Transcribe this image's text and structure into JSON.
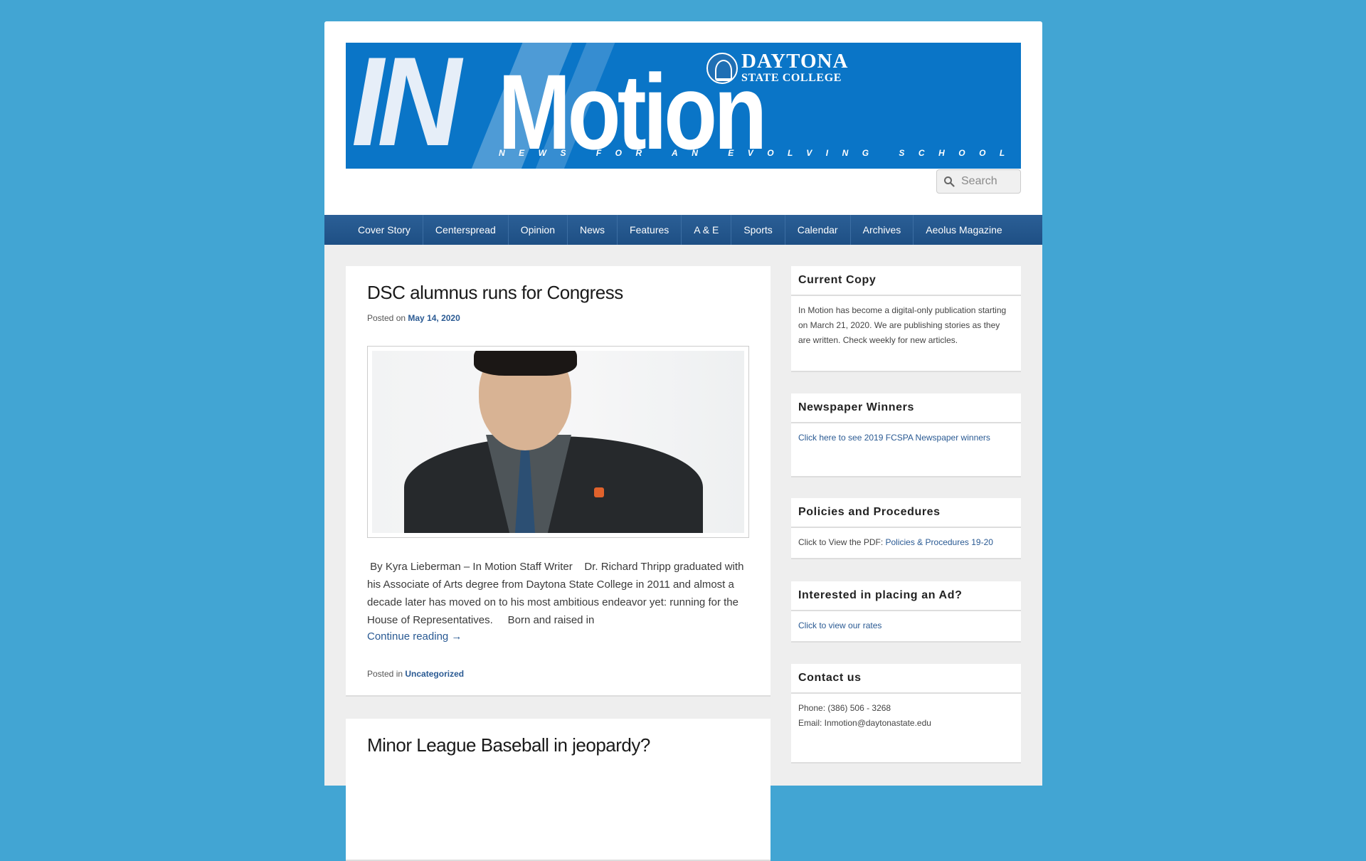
{
  "site": {
    "logo": {
      "in_text": "IN",
      "motion_text": "Motion",
      "tagline": "NEWS FOR AN EVOLVING SCHOOL",
      "college_line1": "DAYTONA",
      "college_line2": "STATE COLLEGE"
    },
    "search": {
      "placeholder": "Search"
    }
  },
  "nav": {
    "items": [
      {
        "label": "Cover Story"
      },
      {
        "label": "Centerspread"
      },
      {
        "label": "Opinion"
      },
      {
        "label": "News"
      },
      {
        "label": "Features"
      },
      {
        "label": "A & E"
      },
      {
        "label": "Sports"
      },
      {
        "label": "Calendar"
      },
      {
        "label": "Archives"
      },
      {
        "label": "Aeolus Magazine"
      }
    ]
  },
  "articles": [
    {
      "title": "DSC alumnus runs for Congress",
      "posted_prefix": "Posted on",
      "date": "May 14, 2020",
      "excerpt": " By Kyra Lieberman – In Motion Staff Writer    Dr. Richard Thripp graduated with his Associate of Arts degree from Daytona State College in 2011 and almost a decade later has moved on to his most ambitious endeavor yet: running for the House of Representatives.     Born and raised in",
      "continue": "Continue reading →",
      "category_prefix": "Posted in",
      "category": "Uncategorized"
    },
    {
      "title": "Minor League Baseball in jeopardy?"
    }
  ],
  "sidebar": {
    "current_copy": {
      "title": "Current Copy",
      "body": "In Motion has become a digital-only publication starting on March 21, 2020. We are publishing stories as they are written. Check weekly for new articles."
    },
    "newspaper_winners": {
      "title": "Newspaper Winners",
      "link": "Click here to see 2019 FCSPA Newspaper winners"
    },
    "policies": {
      "title": "Policies and Procedures",
      "prefix": "Click to View the PDF:",
      "link": "Policies & Procedures 19-20"
    },
    "ads": {
      "title": "Interested in placing an Ad?",
      "link": "Click to view our rates"
    },
    "contact": {
      "title": "Contact us",
      "phone": "Phone: (386) 506 - 3268",
      "email": "Email: Inmotion@daytonastate.edu"
    }
  },
  "colors": {
    "background": "#42a5d3",
    "banner": "#0a75c7",
    "nav": "#1e4f84",
    "link": "#2a5a93"
  }
}
